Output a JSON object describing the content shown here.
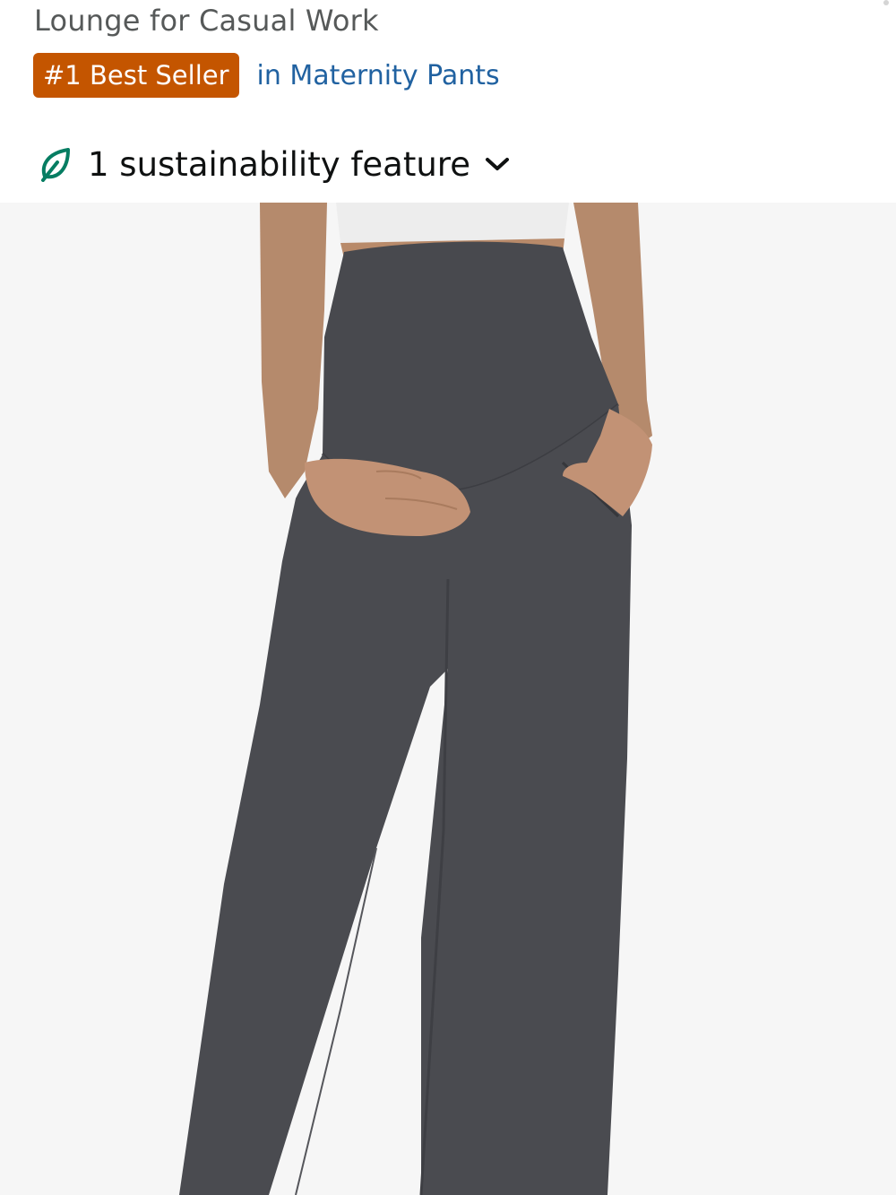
{
  "product": {
    "title_tail": "Lounge for Casual Work",
    "badge_label": "#1 Best Seller",
    "badge_category": "in Maternity Pants"
  },
  "sustainability": {
    "label": "1 sustainability feature",
    "icon": "leaf-icon",
    "expand_icon": "chevron-down-icon"
  },
  "image": {
    "alt": "Maternity wide-leg pants, dark gray, over-the-belly waistband with side pockets"
  },
  "colors": {
    "badge_bg": "#c45500",
    "link": "#2162a1",
    "leaf": "#067d62",
    "pants": "#4a4b50"
  }
}
